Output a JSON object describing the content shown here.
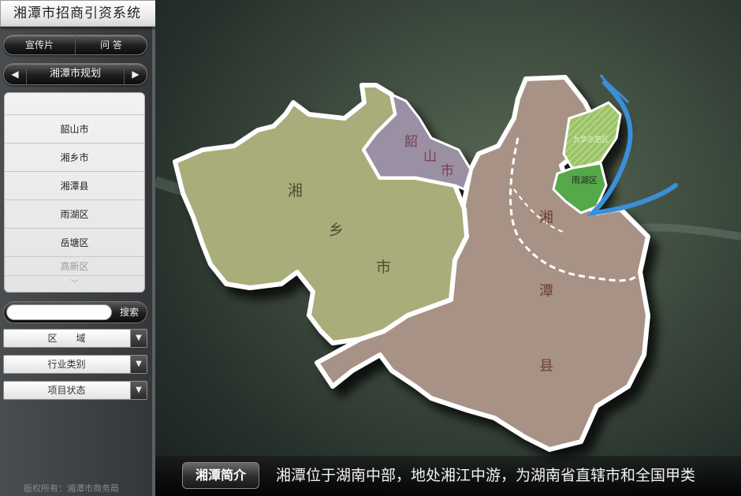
{
  "app": {
    "title": "湘潭市招商引资系统"
  },
  "sidebar": {
    "top_tabs": [
      "宣传片",
      "问 答"
    ],
    "nav": {
      "label": "湘潭市规划",
      "prev": "◀",
      "next": "▶"
    },
    "list_items": [
      "韶山市",
      "湘乡市",
      "湘潭县",
      "雨湖区",
      "岳塘区",
      "高新区"
    ],
    "search": {
      "value": "",
      "button": "搜索"
    },
    "filters": [
      "区　　域",
      "行业类别",
      "项目状态"
    ],
    "dropdown_icon": "▼",
    "scroll_icon": "chevron-down-icon",
    "copyright": "版权所有：湘潭市商务局"
  },
  "map": {
    "regions": {
      "shaoshan": [
        "韶",
        "山",
        "市"
      ],
      "xiangxiang": [
        "湘",
        "乡",
        "市"
      ],
      "xiangtan_county": [
        "湘",
        "潭",
        "县"
      ],
      "yuhu": "雨湖区",
      "jiuhua": "九华示范区"
    },
    "colors": {
      "xiangxiang": "#a8ad7a",
      "shaoshan": "#9b8fa3",
      "xiangtan_county": "#a89286",
      "yuhu": "#56a84c",
      "jiuhua": "#9cc36a",
      "river": "#3b8fd9"
    }
  },
  "ticker": {
    "button": "湘潭简介",
    "text": "湘潭位于湖南中部，地处湘江中游，为湖南省直辖市和全国甲类"
  }
}
